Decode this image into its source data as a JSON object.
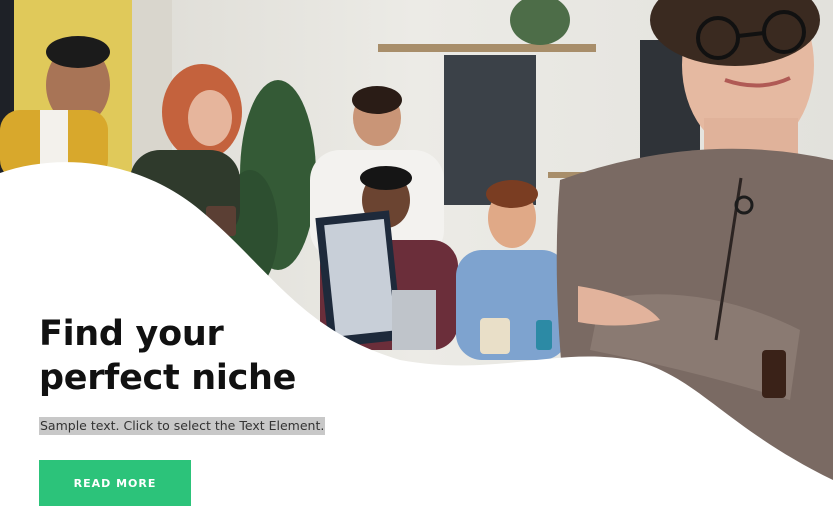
{
  "hero": {
    "headline_line1": "Find your",
    "headline_line2": "perfect niche",
    "sample_text": "Sample text. Click to select the Text Element.",
    "button_label": "READ MORE",
    "image": "office-team-with-smiling-woman-photo"
  },
  "colors": {
    "accent": "#2cc37a",
    "text": "#111111",
    "background": "#ffffff"
  }
}
